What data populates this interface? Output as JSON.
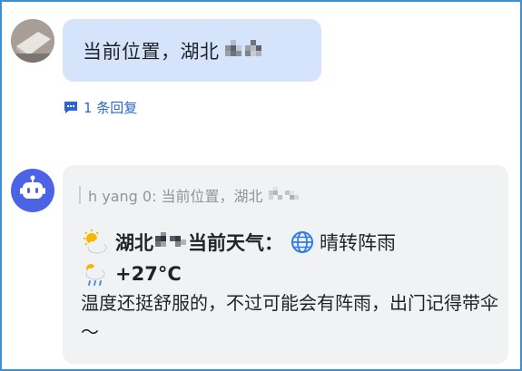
{
  "user_message": {
    "text": "当前位置，湖北"
  },
  "reply_count_label": "1 条回复",
  "bot_message": {
    "quote": "h yang 0: 当前位置，湖北",
    "weather_location": "湖北",
    "weather_title": "当前天气：",
    "weather_condition": "晴转阵雨",
    "temperature": "+27°C",
    "comment": "温度还挺舒服的，不过可能会有阵雨，出门记得带伞～"
  },
  "colors": {
    "border": "#3d8fd6",
    "user_bubble": "#d6e4fb",
    "bot_bubble": "#f1f2f4",
    "link": "#2b66d0",
    "bot_avatar": "#4c63e6"
  }
}
